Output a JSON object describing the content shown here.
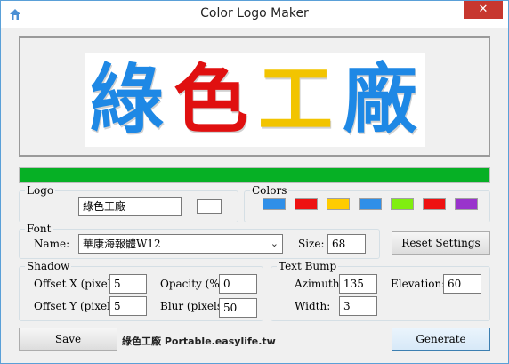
{
  "window": {
    "title": "Color Logo Maker",
    "close_glyph": "✕"
  },
  "logo_preview": {
    "characters": [
      {
        "char": "綠",
        "color": "#1e88e5"
      },
      {
        "char": "色",
        "color": "#e01010"
      },
      {
        "char": "工",
        "color": "#f2c400"
      },
      {
        "char": "廠",
        "color": "#1e88e5"
      }
    ]
  },
  "progress": {
    "value": 1.0,
    "color": "#06b025"
  },
  "logo": {
    "label": "Logo",
    "text": "綠色工廠"
  },
  "colors": {
    "label": "Colors",
    "swatches": [
      "#2f8fe8",
      "#ee1111",
      "#ffcc00",
      "#2f8fe8",
      "#80ee10",
      "#ee1111",
      "#9933cc"
    ]
  },
  "font": {
    "label": "Font",
    "name_label": "Name:",
    "name_value": "華康海報體W12",
    "size_label": "Size:",
    "size_value": "68"
  },
  "reset_button": "Reset Settings",
  "shadow": {
    "label": "Shadow",
    "offset_x_label": "Offset X (pixels):",
    "offset_x_value": "5",
    "offset_y_label": "Offset Y (pixels):",
    "offset_y_value": "5",
    "opacity_label": "Opacity (%):",
    "opacity_value": "0",
    "blur_label": "Blur (pixels):",
    "blur_value": "50"
  },
  "bump": {
    "label": "Text Bump",
    "azimuth_label": "Azimuth:",
    "azimuth_value": "135",
    "elevation_label": "Elevation:",
    "elevation_value": "60",
    "width_label": "Width:",
    "width_value": "3"
  },
  "save_button": "Save",
  "generate_button": "Generate",
  "watermark": "綠色工廠 Portable.easylife.tw",
  "icons": {
    "app": "home-icon",
    "close": "close-icon",
    "dropdown": "chevron-down-icon"
  }
}
